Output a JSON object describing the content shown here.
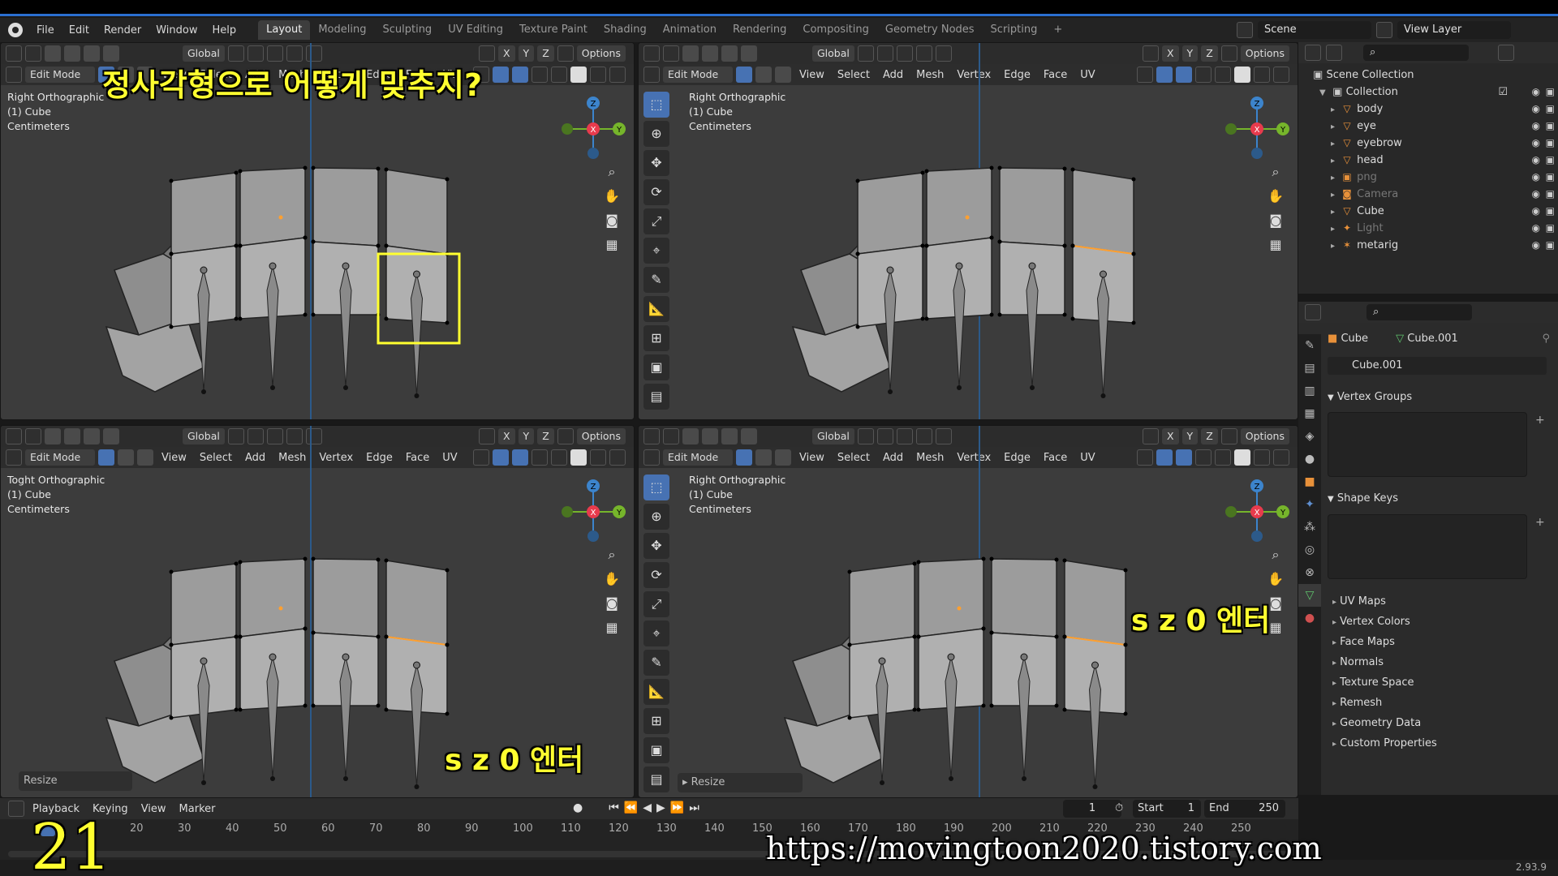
{
  "menubar": {
    "menus": [
      "File",
      "Edit",
      "Render",
      "Window",
      "Help"
    ],
    "workspaces": [
      "Layout",
      "Modeling",
      "Sculpting",
      "UV Editing",
      "Texture Paint",
      "Shading",
      "Animation",
      "Rendering",
      "Compositing",
      "Geometry Nodes",
      "Scripting"
    ],
    "add_tab": "+",
    "scene": "Scene",
    "view_layer": "View Layer"
  },
  "viewport_header": {
    "orientation": "Global",
    "options": "Options",
    "axes": [
      "X",
      "Y",
      "Z"
    ],
    "mode": "Edit Mode",
    "menus": [
      "View",
      "Select",
      "Add",
      "Mesh",
      "Vertex",
      "Edge",
      "Face",
      "UV"
    ]
  },
  "viewports": [
    {
      "view": "Right Orthographic",
      "object": "(1) Cube",
      "units": "Centimeters"
    },
    {
      "view": "Right Orthographic",
      "object": "(1) Cube",
      "units": "Centimeters"
    },
    {
      "view": "Toght Orthographic",
      "object": "(1) Cube",
      "units": "Centimeters"
    },
    {
      "view": "Right Orthographic",
      "object": "(1) Cube",
      "units": "Centimeters"
    }
  ],
  "overlays": {
    "question": "정사각형으로 어떻게 맞추지?",
    "cmd_bottom_left": "s z 0 엔터",
    "cmd_bottom_right": "s z 0 엔터",
    "frame_number": "21",
    "url": "https://movingtoon2020.tistory.com"
  },
  "resize_panel": {
    "label": "Resize",
    "label_arrow": "▸ Resize"
  },
  "outliner": {
    "scene_collection": "Scene Collection",
    "collection": "Collection",
    "items": [
      {
        "name": "body",
        "dim": false
      },
      {
        "name": "eye",
        "dim": false
      },
      {
        "name": "eyebrow",
        "dim": false
      },
      {
        "name": "head",
        "dim": false
      },
      {
        "name": "png",
        "dim": true
      },
      {
        "name": "Camera",
        "dim": true
      },
      {
        "name": "Cube",
        "dim": false
      },
      {
        "name": "Light",
        "dim": true
      },
      {
        "name": "metarig",
        "dim": false
      }
    ]
  },
  "properties": {
    "object": "Cube",
    "mesh": "Cube.001",
    "mesh_field": "Cube.001",
    "panels": [
      "Vertex Groups",
      "Shape Keys"
    ],
    "subpanels": [
      "UV Maps",
      "Vertex Colors",
      "Face Maps",
      "Normals",
      "Texture Space",
      "Remesh",
      "Geometry Data",
      "Custom Properties"
    ]
  },
  "timeline": {
    "menus": [
      "Playback",
      "Keying",
      "View",
      "Marker"
    ],
    "current_frame": "1",
    "start_label": "Start",
    "start": "1",
    "end_label": "End",
    "end": "250",
    "ticks": [
      "20",
      "30",
      "40",
      "50",
      "60",
      "70",
      "80",
      "90",
      "100",
      "110",
      "120",
      "130",
      "140",
      "150",
      "160",
      "170",
      "180",
      "190",
      "200",
      "210",
      "220",
      "230",
      "240",
      "250"
    ]
  },
  "status": {
    "version": "2.93.9"
  },
  "colors": {
    "accent": "#4772b3",
    "selected": "#ffa030",
    "overlay_yellow": "#ffff30",
    "axis_x": "#e83b4d",
    "axis_y": "#76b52b",
    "axis_z": "#3c84cc"
  }
}
